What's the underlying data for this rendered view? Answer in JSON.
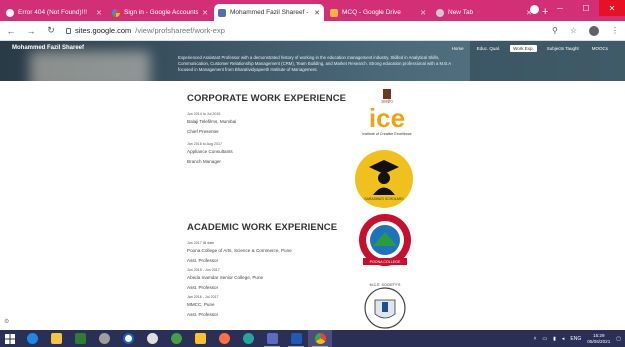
{
  "browser": {
    "tabs": [
      {
        "label": "Error 404 (Not Found)!!!",
        "icon": "globe-icon",
        "active": false
      },
      {
        "label": "Sign in - Google Accounts",
        "icon": "google-icon",
        "active": false
      },
      {
        "label": "Mohammed Fazil Shareef - W",
        "icon": "sites-icon",
        "active": true
      },
      {
        "label": "MCQ - Google Drive",
        "icon": "drive-icon",
        "active": false
      },
      {
        "label": "New Tab",
        "icon": "newtab-icon",
        "active": false
      }
    ],
    "url_host": "sites.google.com",
    "url_path": "/view/profshareef/work-exp",
    "accent": "#d32f77"
  },
  "site": {
    "title": "Mohammed Fazil Shareef",
    "nav": [
      {
        "label": "Home",
        "current": false
      },
      {
        "label": "Educ. Qual.",
        "current": false
      },
      {
        "label": "Work Exp.",
        "current": true
      },
      {
        "label": "Subjects Taught",
        "current": false
      },
      {
        "label": "MOOCs",
        "current": false
      }
    ],
    "summary": "Experienced Assistant Professor with a demonstrated history of working in the education management industry. Skilled in Analytical Skills, Communication, Customer Relationship Management (CRM), Team Building, and Market Research. Strong education professional with a M.B.A focused in Management from Bharatividyapeeth Institute of Management."
  },
  "corporate": {
    "heading": "CORPORATE WORK EXPERIENCE",
    "entries": [
      {
        "dates": "Jun 2014 to Jul 2015",
        "org": "Balaji Telefilms, Mumbai",
        "role": "Chief Presenter"
      },
      {
        "dates": "Jan 2016 to Aug 2017",
        "org": "Appliance Consultants",
        "role": "Branch Manager"
      }
    ]
  },
  "academic": {
    "heading": "ACADEMIC WORK EXPERIENCE",
    "entries": [
      {
        "dates": "Jun 2017 till date",
        "org": "Poona College of Arts, Science & Commerce, Pune",
        "role": "Asst. Professor"
      },
      {
        "dates": "Jun 2015 - Jun 2017",
        "org": "Abeda Inamdar Senior College, Pune",
        "role": "Asst. Professor"
      },
      {
        "dates": "Jan 2016 - Jul 2017",
        "org": "MMCC, Pune",
        "role": "Asst. Professor"
      }
    ]
  },
  "logos": {
    "ice_main": "ice",
    "ice_sub": "Institute of Creative Excellence",
    "ice_top": "ज्ञानदीप",
    "badge_text": "SARASWATI SCHOLARS",
    "seal_text": "POONA COLLEGE",
    "seal2_text": "M.C.E. SOCIETY'S"
  },
  "taskbar": {
    "language": "ENG",
    "time": "15:29",
    "date": "05/06/2021"
  }
}
